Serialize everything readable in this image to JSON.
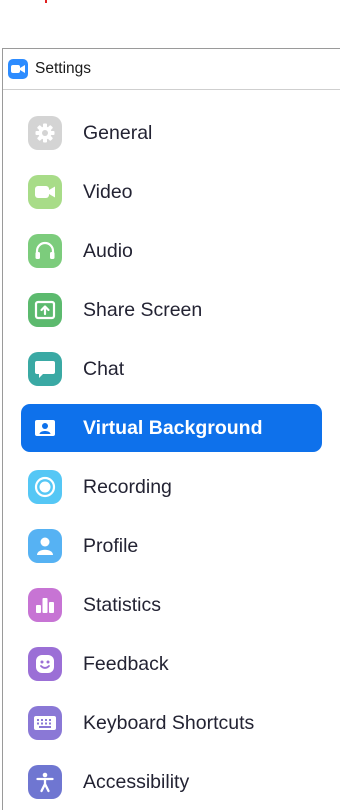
{
  "window": {
    "title": "Settings",
    "app_icon": "video-camera-icon",
    "brand_color": "#2d8cff"
  },
  "sidebar": {
    "active_index": 5,
    "active_color": "#0e71eb",
    "items": [
      {
        "label": "General",
        "icon": "gear-icon",
        "color": "#d4d4d4"
      },
      {
        "label": "Video",
        "icon": "video-camera-icon",
        "color": "#a8dc88"
      },
      {
        "label": "Audio",
        "icon": "headphones-icon",
        "color": "#7ccc7c"
      },
      {
        "label": "Share Screen",
        "icon": "share-screen-icon",
        "color": "#5cba6e"
      },
      {
        "label": "Chat",
        "icon": "chat-bubble-icon",
        "color": "#3aa9a4"
      },
      {
        "label": "Virtual Background",
        "icon": "person-card-icon",
        "color": "#0e71eb"
      },
      {
        "label": "Recording",
        "icon": "record-icon",
        "color": "#55c7f5"
      },
      {
        "label": "Profile",
        "icon": "person-icon",
        "color": "#56b2f3"
      },
      {
        "label": "Statistics",
        "icon": "bar-chart-icon",
        "color": "#c774d4"
      },
      {
        "label": "Feedback",
        "icon": "smiley-icon",
        "color": "#9b6fd6"
      },
      {
        "label": "Keyboard Shortcuts",
        "icon": "keyboard-icon",
        "color": "#8a78d6"
      },
      {
        "label": "Accessibility",
        "icon": "accessibility-icon",
        "color": "#6f76d1"
      }
    ]
  }
}
